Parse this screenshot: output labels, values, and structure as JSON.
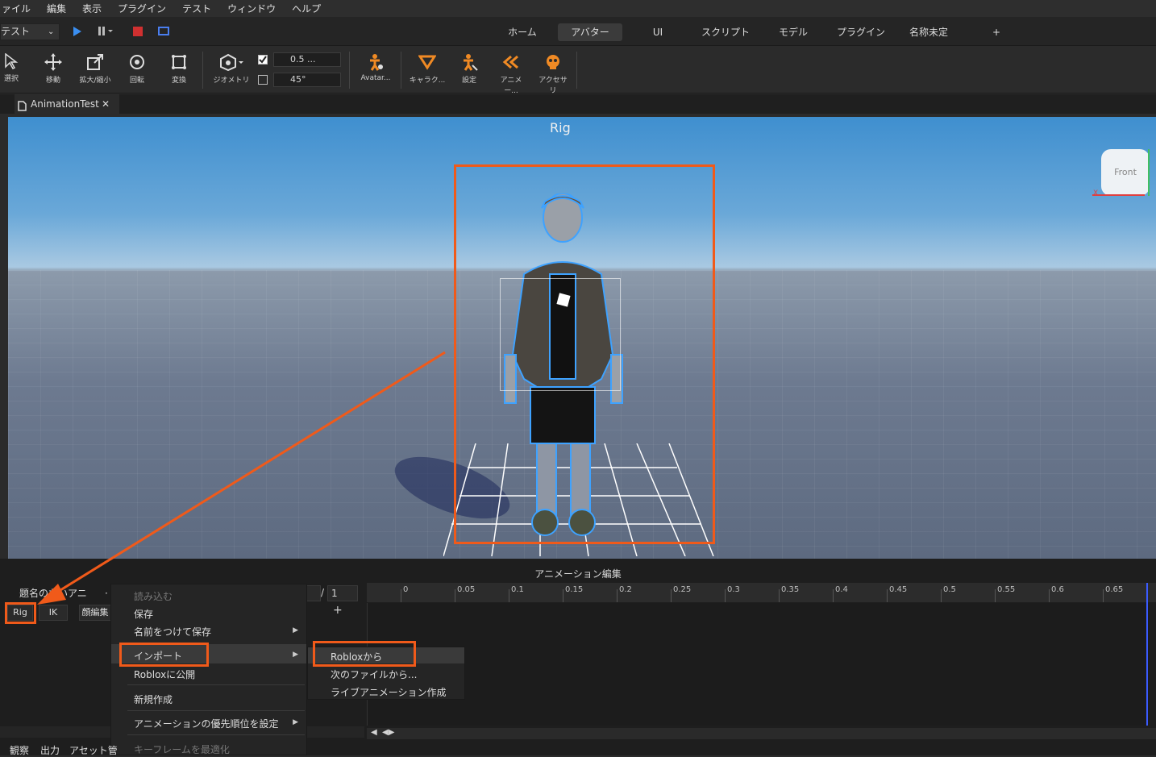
{
  "menubar": [
    "ァイル",
    "編集",
    "表示",
    "プラグイン",
    "テスト",
    "ウィンドウ",
    "ヘルプ"
  ],
  "test_select": "テスト",
  "ribbon_tabs": [
    "ホーム",
    "アバター",
    "UI",
    "スクリプト",
    "モデル",
    "プラグイン",
    "名称未定",
    "+"
  ],
  "tools": {
    "select": "選択",
    "move": "移動",
    "scale": "拡大/縮小",
    "rotate": "回転",
    "transform": "変換",
    "geometry": "ジオメトリ",
    "snap_move": "0.5 ...",
    "snap_rotate": "45°",
    "avatar": "Avatar...",
    "character": "キャラク...",
    "settings": "設定",
    "animation": "アニメー...",
    "accessory": "アクセサリ"
  },
  "doc_tab": "AnimationTest",
  "viewport": {
    "title": "Rig",
    "cube_label": "Front",
    "axis_x": "X"
  },
  "panel": {
    "title": "アニメーション編集",
    "anim_name": "題名のないアニ",
    "frame_current": "",
    "frame_total": "1",
    "rig_btn": "Rig",
    "ik_btn": "IK",
    "face_btn": "顔編集",
    "ticks": [
      "0",
      "0.05",
      "0.1",
      "0.15",
      "0.2",
      "0.25",
      "0.3",
      "0.35",
      "0.4",
      "0.45",
      "0.5",
      "0.55",
      "0.6",
      "0.65"
    ]
  },
  "menu": {
    "load": "読み込む",
    "save": "保存",
    "save_as": "名前をつけて保存",
    "import": "インポート",
    "publish": "Robloxに公開",
    "new": "新規作成",
    "priority": "アニメーションの優先順位を設定",
    "optimize": "キーフレームを最適化"
  },
  "submenu": {
    "from_roblox": "Robloxから",
    "from_file": "次のファイルから...",
    "live": "ライブアニメーション作成"
  },
  "bottom_tabs": [
    "観察",
    "出力",
    "アセット管"
  ]
}
